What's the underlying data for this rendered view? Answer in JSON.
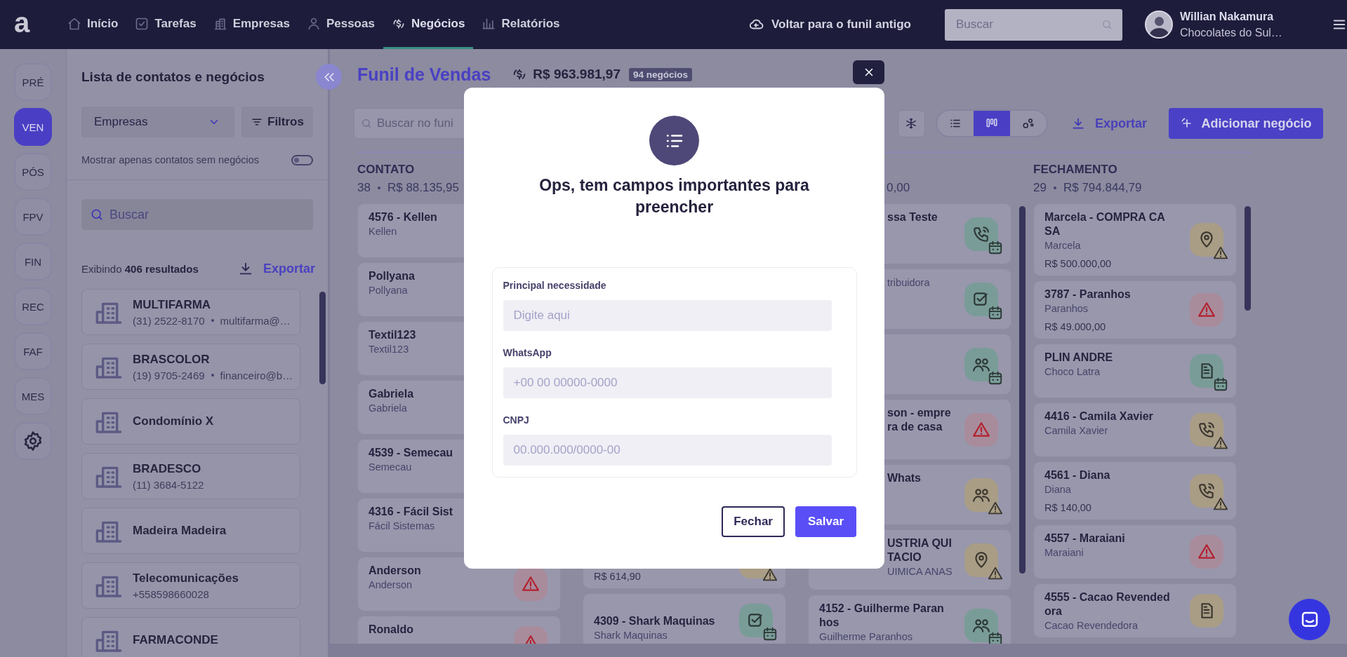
{
  "topbar": {
    "logo": "a",
    "nav": [
      {
        "label": "Início",
        "kind": "home",
        "selected": false
      },
      {
        "label": "Tarefas",
        "kind": "task",
        "selected": false
      },
      {
        "label": "Empresas",
        "kind": "building",
        "selected": false
      },
      {
        "label": "Pessoas",
        "kind": "person",
        "selected": false
      },
      {
        "label": "Negócios",
        "kind": "money",
        "selected": true
      },
      {
        "label": "Relatórios",
        "kind": "chart",
        "selected": false
      }
    ],
    "back_link": "Voltar para o funil antigo",
    "search": {
      "placeholder": "Buscar"
    },
    "user": {
      "name": "Willian Nakamura",
      "company": "Chocolates do Sul…"
    }
  },
  "rail": [
    {
      "label": "PRÉ",
      "selected": false
    },
    {
      "label": "VEN",
      "selected": true
    },
    {
      "label": "PÓS",
      "selected": false
    },
    {
      "label": "FPV",
      "selected": false
    },
    {
      "label": "FIN",
      "selected": false
    },
    {
      "label": "REC",
      "selected": false
    },
    {
      "label": "FAF",
      "selected": false
    },
    {
      "label": "MES",
      "selected": false
    }
  ],
  "sidebar": {
    "title": "Lista de contatos e negócios",
    "type_select": "Empresas",
    "filter_button": "Filtros",
    "toggle": {
      "label": "Mostrar apenas contatos sem negócios",
      "on": false
    },
    "search": {
      "placeholder": "Buscar"
    },
    "results": "Exibindo **406 resultados**",
    "export": "Exportar",
    "items": [
      {
        "name": "MULTIFARMA",
        "phone": "(31) 2522-8170",
        "email": "multifarma@…"
      },
      {
        "name": "BRASCOLOR",
        "phone": "(19) 9705-2469",
        "email": "financeiro@b…"
      },
      {
        "name": "Condomínio X"
      },
      {
        "name": "BRADESCO",
        "phone": "(11) 3684-5122"
      },
      {
        "name": "Madeira Madeira"
      },
      {
        "name": "Telecomunicações",
        "phone": "+558598660028"
      },
      {
        "name": "FARMACONDE"
      }
    ]
  },
  "funnel": {
    "title": "Funil de Vendas",
    "total": "R$ 963.981,97",
    "count_badge": "94 negócios",
    "search": {
      "placeholder": "Buscar no funi"
    },
    "views": [
      {
        "kind": "list",
        "selected": false
      },
      {
        "kind": "kanban",
        "selected": true
      },
      {
        "kind": "nodes",
        "selected": false
      }
    ],
    "export": "Exportar",
    "add_button": "Adicionar negócio",
    "columns": [
      {
        "title": "CONTATO",
        "count": "38",
        "total": "R$ 88.135,95",
        "cards": [
          {
            "title": "4576 - Kellen",
            "subtitle": "Kellen"
          },
          {
            "title": "Pollyana",
            "subtitle": "Pollyana"
          },
          {
            "title": "Textil123",
            "subtitle": "Textil123"
          },
          {
            "title": "Gabriela",
            "subtitle": "Gabriela"
          },
          {
            "title": "4539 - Semecau",
            "subtitle": "Semecau"
          },
          {
            "title": "4316 - Fácil Sist",
            "subtitle": "Fácil Sistemas"
          },
          {
            "title": "Anderson",
            "subtitle": "Anderson",
            "color": "#a98c9c",
            "icons": [
              {
                "kind": "warning"
              }
            ]
          },
          {
            "title": "Ronaldo",
            "color": "#a98c9c",
            "icons": [
              {
                "kind": "warning"
              }
            ]
          }
        ]
      },
      {
        "cards": [
          {
            "value": "R$ 614,90",
            "color": "#a99d86",
            "icons": [
              {
                "kind": "none"
              },
              {
                "kind": "warning"
              }
            ]
          },
          {
            "title": "4309 - Shark Maquinas",
            "subtitle": "Shark Maquinas",
            "color": "#7a9c98",
            "icons": [
              {
                "kind": "check"
              },
              {
                "kind": "calendar"
              }
            ]
          }
        ]
      },
      {
        "total": "0,00",
        "covered": true,
        "cards": [
          {
            "title_lines": [
              "ssa Teste"
            ],
            "color": "#7a9c98",
            "icons": [
              {
                "kind": "phone"
              },
              {
                "kind": "calendar"
              }
            ],
            "covered": true
          },
          {
            "subtitle": "tribuidora",
            "color": "#7a9c98",
            "icons": [
              {
                "kind": "check"
              },
              {
                "kind": "calendar"
              }
            ],
            "covered": true
          },
          {
            "color": "#7a9c98",
            "icons": [
              {
                "kind": "people"
              },
              {
                "kind": "calendar"
              }
            ]
          },
          {
            "title_lines": [
              "son - empre",
              "ra de casa"
            ],
            "color": "#a98c9c",
            "icons": [
              {
                "kind": "warning"
              }
            ],
            "covered": true
          },
          {
            "title_lines": [
              "Whats"
            ],
            "color": "#a99d86",
            "icons": [
              {
                "kind": "people"
              },
              {
                "kind": "warning"
              }
            ],
            "covered": true
          },
          {
            "title_lines": [
              "USTRIA QUI",
              "TACIO"
            ],
            "subtitle": "UIMICA ANAS",
            "color": "#a99d86",
            "icons": [
              {
                "kind": "location"
              },
              {
                "kind": "warning"
              }
            ],
            "covered": true
          },
          {
            "title": "4152 - Guilherme Paranhos",
            "subtitle": "Guilherme Paranhos",
            "color": "#7a9c98",
            "icons": [
              {
                "kind": "people"
              },
              {
                "kind": "calendar"
              }
            ]
          }
        ]
      },
      {
        "title": "FECHAMENTO",
        "count": "29",
        "total": "R$ 794.844,79",
        "cards": [
          {
            "title": "Marcela - COMPRA CASA",
            "subtitle": "Marcela",
            "value": "R$ 500.000,00",
            "color": "#a99d86",
            "icons": [
              {
                "kind": "location"
              },
              {
                "kind": "warning"
              }
            ]
          },
          {
            "title": "3787 - Paranhos",
            "subtitle": "Paranhos",
            "value": "R$ 49.000,00",
            "color": "#a98c9c",
            "icons": [
              {
                "kind": "warning"
              }
            ]
          },
          {
            "title": "PLIN ANDRE",
            "subtitle": "Choco Latra",
            "color": "#7a9c98",
            "icons": [
              {
                "kind": "document"
              },
              {
                "kind": "calendar"
              }
            ]
          },
          {
            "title": "4416 - Camila Xavier",
            "subtitle": "Camila Xavier",
            "color": "#a99d86",
            "icons": [
              {
                "kind": "phone"
              },
              {
                "kind": "warning"
              }
            ]
          },
          {
            "title": "4561 - Diana",
            "subtitle": "Diana",
            "value": "R$ 140,00",
            "color": "#a99d86",
            "icons": [
              {
                "kind": "phone"
              },
              {
                "kind": "warning"
              }
            ]
          },
          {
            "title": "4557 - Maraiani",
            "subtitle": "Maraiani",
            "color": "#a98c9c",
            "icons": [
              {
                "kind": "warning"
              }
            ]
          },
          {
            "title": "4555 - Cacao Revendedora",
            "subtitle": "Cacao Revendedora",
            "color": "#a99d86",
            "icons": [
              {
                "kind": "document"
              }
            ]
          }
        ]
      }
    ]
  },
  "modal": {
    "title": "Ops, tem campos importantes para preencher",
    "fields": [
      {
        "label": "Principal necessidade",
        "placeholder": "Digite aqui"
      },
      {
        "label": "WhatsApp",
        "placeholder": "+00 00 00000-0000"
      },
      {
        "label": "CNPJ",
        "placeholder": "00.000.000/0000-00"
      }
    ],
    "buttons": [
      {
        "label": "Fechar",
        "kind": "secondary"
      },
      {
        "label": "Salvar",
        "kind": "primary"
      }
    ]
  }
}
